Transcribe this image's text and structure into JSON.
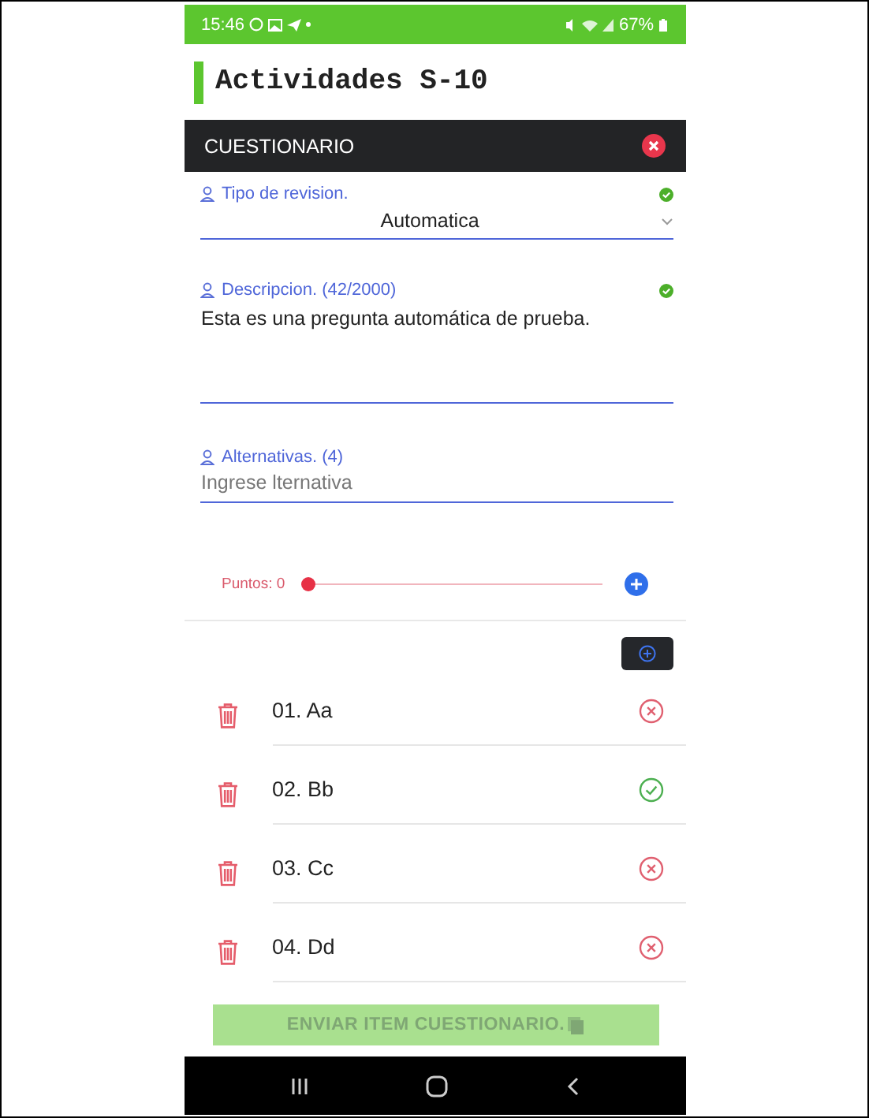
{
  "status_bar": {
    "time": "15:46",
    "battery": "67%"
  },
  "page_title": "Actividades S-10",
  "panel": {
    "title": "CUESTIONARIO"
  },
  "fields": [
    {
      "kind": "select",
      "label": "Tipo de revision.",
      "valid": true,
      "value": "Automatica"
    },
    {
      "kind": "textarea",
      "label": "Descripcion. (42/2000)",
      "valid": true,
      "value": "Esta es una pregunta automática de prueba."
    },
    {
      "kind": "input",
      "label": "Alternativas. (4)",
      "valid": false,
      "placeholder": "Ingrese lternativa"
    }
  ],
  "points": {
    "label": "Puntos: 0",
    "level": 0
  },
  "alternatives": [
    {
      "label": "01. Aa",
      "correct": false
    },
    {
      "label": "02. Bb",
      "correct": true
    },
    {
      "label": "03. Cc",
      "correct": false
    },
    {
      "label": "04. Dd",
      "correct": false
    }
  ],
  "submit": {
    "label": "ENVIAR ITEM CUESTIONARIO.",
    "disabled": true
  }
}
